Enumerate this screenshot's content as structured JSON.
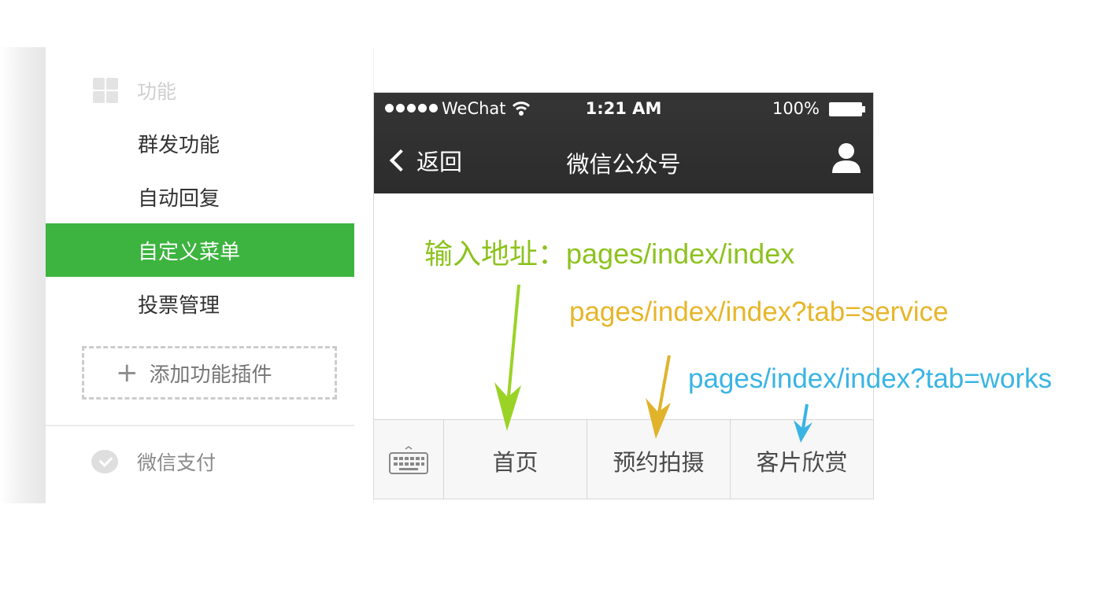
{
  "sidebar": {
    "section_title": "功能",
    "section_icon": "grid-icon",
    "items": [
      {
        "label": "群发功能",
        "active": false
      },
      {
        "label": "自动回复",
        "active": false
      },
      {
        "label": "自定义菜单",
        "active": true
      },
      {
        "label": "投票管理",
        "active": false
      }
    ],
    "add_plugin_label": "添加功能插件",
    "payment_label": "微信支付",
    "accent_color": "#3cb43f"
  },
  "phone": {
    "status_bar": {
      "carrier": "WeChat",
      "time": "1:21 AM",
      "battery": "100%"
    },
    "nav": {
      "back_label": "返回",
      "title": "微信公众号"
    },
    "menu": {
      "keyboard_icon": "keyboard-icon",
      "items": [
        "首页",
        "预约拍摄",
        "客片欣赏"
      ]
    }
  },
  "annotations": {
    "home": {
      "text": "输入地址：pages/index/index",
      "color": "#8dc21f"
    },
    "booking": {
      "text": "pages/index/index?tab=service",
      "color": "#e6b62a"
    },
    "gallery": {
      "text": "pages/index/index?tab=works",
      "color": "#3ab4e4"
    }
  }
}
